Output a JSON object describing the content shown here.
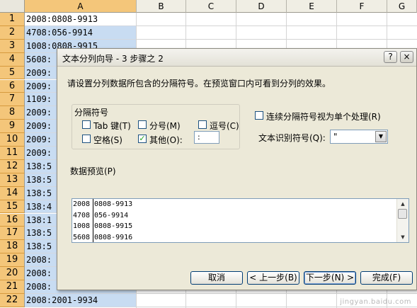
{
  "sheet": {
    "columns": [
      "A",
      "B",
      "C",
      "D",
      "E",
      "F",
      "G"
    ],
    "selected_column": "A",
    "rows": [
      {
        "num": "1",
        "a": "2008:0808-9913"
      },
      {
        "num": "2",
        "a": "4708:056-9914"
      },
      {
        "num": "3",
        "a": "1008:0808-9915"
      },
      {
        "num": "4",
        "a": "5608:"
      },
      {
        "num": "5",
        "a": "2009:"
      },
      {
        "num": "6",
        "a": "2009:"
      },
      {
        "num": "7",
        "a": "1109:"
      },
      {
        "num": "8",
        "a": "2009:"
      },
      {
        "num": "9",
        "a": "2009:"
      },
      {
        "num": "10",
        "a": "2009:"
      },
      {
        "num": "11",
        "a": "2009:"
      },
      {
        "num": "12",
        "a": "138:5"
      },
      {
        "num": "13",
        "a": "138:5"
      },
      {
        "num": "14",
        "a": "138:5"
      },
      {
        "num": "15",
        "a": "138:4"
      },
      {
        "num": "16",
        "a": "138:1"
      },
      {
        "num": "17",
        "a": "138:5"
      },
      {
        "num": "18",
        "a": "138:5"
      },
      {
        "num": "19",
        "a": "2008:"
      },
      {
        "num": "20",
        "a": "2008:"
      },
      {
        "num": "21",
        "a": "2008:"
      },
      {
        "num": "22",
        "a": "2008:2001-9934"
      }
    ]
  },
  "dialog": {
    "title": "文本分列向导 - 3 步骤之 2",
    "help_glyph": "?",
    "close_glyph": "×",
    "description": "请设置分列数据所包含的分隔符号。在预览窗口内可看到分列的效果。",
    "delimiters": {
      "group_label": "分隔符号",
      "tab": {
        "label": "Tab 键(T)",
        "checked": false
      },
      "semicolon": {
        "label": "分号(M)",
        "checked": false
      },
      "comma": {
        "label": "逗号(C)",
        "checked": false
      },
      "space": {
        "label": "空格(S)",
        "checked": false
      },
      "other": {
        "label": "其他(O):",
        "checked": true,
        "value": ":"
      }
    },
    "consecutive": {
      "label": "连续分隔符号视为单个处理(R)",
      "checked": false
    },
    "qualifier": {
      "label": "文本识别符号(Q):",
      "value": "\""
    },
    "preview": {
      "label": "数据预览(P)",
      "rows": [
        [
          "2008",
          "0808-9913"
        ],
        [
          "4708",
          "056-9914"
        ],
        [
          "1008",
          "0808-9915"
        ],
        [
          "5608",
          "0808-9916"
        ]
      ]
    },
    "buttons": {
      "cancel": "取消",
      "back": "< 上一步(B)",
      "next": "下一步(N) >",
      "finish": "完成(F)"
    }
  },
  "watermark": "jingyan.baidu.com",
  "colors": {
    "row_header": "#f4c67a",
    "selection": "#c8dcf2",
    "dialog_bg": "#ece9d8"
  }
}
